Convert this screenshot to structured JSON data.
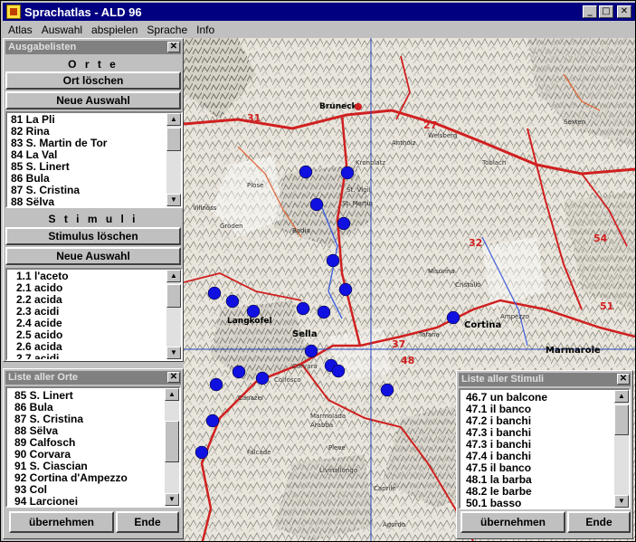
{
  "window": {
    "title": "Sprachatlas - ALD 96"
  },
  "menu": [
    "Atlas",
    "Auswahl",
    "abspielen",
    "Sprache",
    "Info"
  ],
  "ausgabe": {
    "title": "Ausgabelisten",
    "orte_label": "O r t e",
    "ort_loeschen": "Ort löschen",
    "neue_auswahl_1": "Neue Auswahl",
    "orte": [
      "81 La Pli",
      "82 Rina",
      "83 S. Martin de Tor",
      "84 La Val",
      "85 S. Linert",
      "86 Bula",
      "87 S. Cristina",
      "88 Sëlva"
    ],
    "stimuli_label": "S t i m u l i",
    "stimulus_loeschen": "Stimulus löschen",
    "neue_auswahl_2": "Neue Auswahl",
    "stimuli": [
      "1.1 l'aceto",
      "2.1 acido",
      "2.2 acida",
      "2.3 acidi",
      "2.4 acide",
      "2.5 acido",
      "2.6 acida",
      "2.7 acidi"
    ]
  },
  "liste_orte": {
    "title": "Liste aller Orte",
    "items": [
      "85 S. Linert",
      "86 Bula",
      "87 S. Cristina",
      "88 Sëlva",
      "89 Calfosch",
      "90 Corvara",
      "91 S. Ciascian",
      "92 Cortina d'Ampezzo",
      "93 Col",
      "94 Larcionei"
    ],
    "ok": "übernehmen",
    "end": "Ende"
  },
  "liste_stimuli": {
    "title": "Liste aller Stimuli",
    "items": [
      "46.7 un balcone",
      "47.1 il banco",
      "47.2 i banchi",
      "47.3 i banchi",
      "47.3 i banchi",
      "47.4 i banchi",
      "47.5 il banco",
      "48.1 la barba",
      "48.2 le barbe",
      "50.1 basso"
    ],
    "ok": "übernehmen",
    "end": "Ende"
  },
  "map": {
    "labels": [
      "Bruneck",
      "Cortina",
      "Langkofel",
      "Sella",
      "Marmarole",
      "Tofana",
      "Cristallo",
      "Sexten",
      "Toblach",
      "Welsberg",
      "Falcade",
      "Agordo",
      "Arabba",
      "Canazei",
      "Pieve",
      "Badia",
      "Colfosco",
      "Plose",
      "St. Martin",
      "Kronplatz",
      "Antholz",
      "St. Vigil",
      "Corvara",
      "Ampezzo",
      "Misurina",
      "Tai",
      "Livinallongo",
      "Caprile",
      "Marmolada",
      "Gröden",
      "Villnöss"
    ],
    "colors": {
      "road": "#d02020",
      "grid": "#2040c0",
      "dot": "#1010e0",
      "relief": "#8a8a80"
    }
  }
}
